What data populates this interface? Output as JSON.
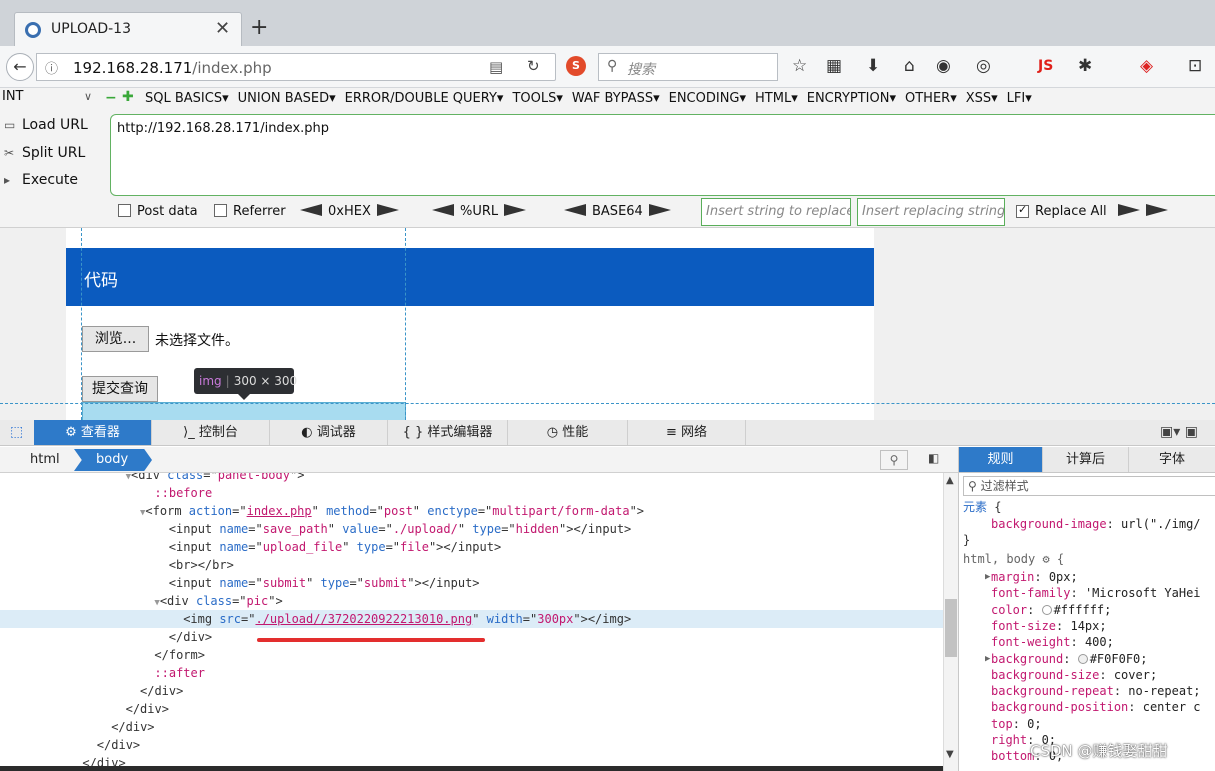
{
  "browser": {
    "tab_title": "UPLOAD-13",
    "tab_close": "✕",
    "new_tab": "+",
    "url_host": "192.168.28.171",
    "url_path": "/index.php",
    "search_placeholder": "搜索",
    "js_label": "JS"
  },
  "hackbar": {
    "select_value": "INT",
    "menu_items": [
      "SQL BASICS▾",
      "UNION BASED▾",
      "ERROR/DOUBLE QUERY▾",
      "TOOLS▾",
      "WAF BYPASS▾",
      "ENCODING▾",
      "HTML▾",
      "ENCRYPTION▾",
      "OTHER▾",
      "XSS▾",
      "LFI▾"
    ],
    "load_url": "Load URL",
    "split_url": "Split URL",
    "execute": "Execute",
    "url_value": "http://192.168.28.171/index.php",
    "post_data": "Post data",
    "referrer": "Referrer",
    "hex": "0xHEX",
    "url_enc": "%URL",
    "base64": "BASE64",
    "replace_placeholder": "Insert string to replace",
    "replacing_placeholder": "Insert replacing string",
    "replace_all": "Replace All"
  },
  "page": {
    "panel_title": "代码",
    "browse_button": "浏览...",
    "no_file": "未选择文件。",
    "submit_button": "提交查询",
    "tooltip_tag": "img",
    "tooltip_size": "300 × 300"
  },
  "devtools": {
    "tabs": [
      "查看器",
      "控制台",
      "调试器",
      "{ } 样式编辑器",
      "性能",
      "网络"
    ],
    "breadcrumb": [
      "html",
      "body"
    ],
    "markup": [
      {
        "indent": 18,
        "open": "<div ",
        "attrs": [
          [
            "class",
            "panel-body"
          ]
        ],
        "close": ">"
      },
      {
        "indent": 22,
        "pseudo": "::before"
      },
      {
        "indent": 20,
        "open": "<form ",
        "attrs": [
          [
            "action",
            "index.php"
          ],
          [
            "method",
            "post"
          ],
          [
            "enctype",
            "multipart/form-data"
          ]
        ],
        "close": ">"
      },
      {
        "indent": 24,
        "open": "<input ",
        "attrs": [
          [
            "name",
            "save_path"
          ],
          [
            "value",
            "./upload/"
          ],
          [
            "type",
            "hidden"
          ]
        ],
        "close": "></input>"
      },
      {
        "indent": 24,
        "open": "<input ",
        "attrs": [
          [
            "name",
            "upload_file"
          ],
          [
            "type",
            "file"
          ]
        ],
        "close": "></input>"
      },
      {
        "indent": 24,
        "open": "<br></br>"
      },
      {
        "indent": 24,
        "open": "<input ",
        "attrs": [
          [
            "name",
            "submit"
          ],
          [
            "type",
            "submit"
          ]
        ],
        "close": "></input>"
      },
      {
        "indent": 22,
        "open": "<div ",
        "attrs": [
          [
            "class",
            "pic"
          ]
        ],
        "close": ">"
      },
      {
        "indent": 26,
        "open": "<img ",
        "attrs": [
          [
            "src",
            "./upload//3720220922213010.png"
          ],
          [
            "width",
            "300px"
          ]
        ],
        "close": "></img>"
      },
      {
        "indent": 24,
        "open": "</div>"
      },
      {
        "indent": 22,
        "open": "</form>"
      },
      {
        "indent": 22,
        "pseudo": "::after"
      },
      {
        "indent": 20,
        "open": "</div>"
      },
      {
        "indent": 18,
        "open": "</div>"
      },
      {
        "indent": 16,
        "open": "</div>"
      },
      {
        "indent": 14,
        "open": "</div>"
      },
      {
        "indent": 12,
        "open": "</div>"
      }
    ],
    "rules_tabs": [
      "规则",
      "计算后",
      "字体"
    ],
    "filter_placeholder": "过滤样式",
    "rule_element": "元素",
    "rule_bg_image_name": "background-image",
    "rule_bg_image_value": "url(\"./img/",
    "rule_selector_html": "html",
    "rule_selector_body": "body",
    "props": [
      {
        "name": "margin",
        "value": "0px;",
        "toggle": true
      },
      {
        "name": "font-family",
        "value": "'Microsoft YaHei"
      },
      {
        "name": "color",
        "value": "#ffffff;",
        "swatch": "#ffffff"
      },
      {
        "name": "font-size",
        "value": "14px;"
      },
      {
        "name": "font-weight",
        "value": "400;"
      },
      {
        "name": "background",
        "value": "#F0F0F0;",
        "swatch": "#F0F0F0",
        "toggle": true
      },
      {
        "name": "background-size",
        "value": "cover;"
      },
      {
        "name": "background-repeat",
        "value": "no-repeat;"
      },
      {
        "name": "background-position",
        "value": "center c"
      },
      {
        "name": "top",
        "value": "0;"
      },
      {
        "name": "right",
        "value": "0;"
      },
      {
        "name": "bottom",
        "value": "0;"
      }
    ]
  },
  "watermark": "CSDN @赚钱娶甜甜"
}
